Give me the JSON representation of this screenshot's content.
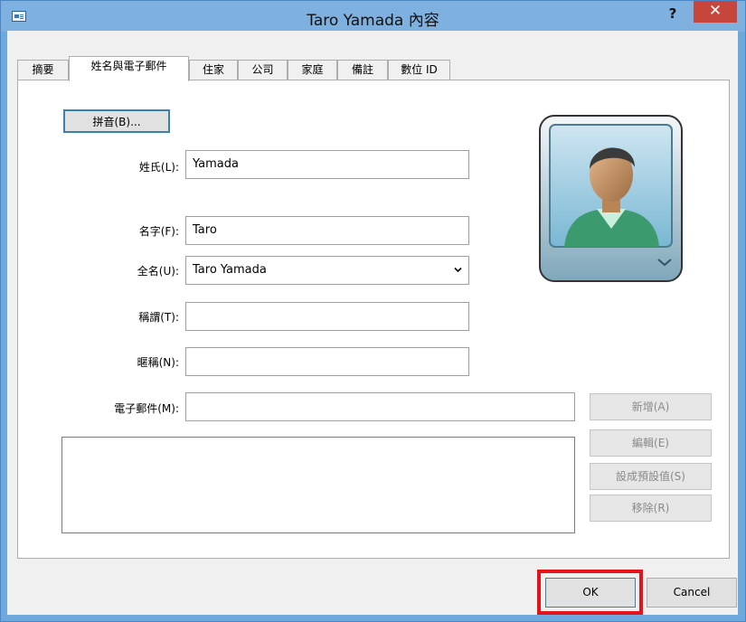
{
  "window": {
    "title": "Taro Yamada 內容",
    "help_label": "?",
    "close_label": "✕",
    "icon": "contact-card-icon"
  },
  "tabs": [
    {
      "label": "摘要"
    },
    {
      "label": "姓名與電子郵件"
    },
    {
      "label": "住家"
    },
    {
      "label": "公司"
    },
    {
      "label": "家庭"
    },
    {
      "label": "備註"
    },
    {
      "label": "數位 ID"
    }
  ],
  "active_tab": "姓名與電子郵件",
  "form": {
    "phonetic_button": "拼音(B)...",
    "last_name": {
      "label": "姓氏(L):",
      "value": "Yamada"
    },
    "first_name": {
      "label": "名字(F):",
      "value": "Taro"
    },
    "full_name": {
      "label": "全名(U):",
      "value": "Taro Yamada"
    },
    "title": {
      "label": "稱謂(T):",
      "value": ""
    },
    "nickname": {
      "label": "暱稱(N):",
      "value": ""
    },
    "email": {
      "label": "電子郵件(M):",
      "value": ""
    }
  },
  "email_buttons": {
    "add": "新增(A)",
    "edit": "編輯(E)",
    "set_default": "設成預設值(S)",
    "remove": "移除(R)"
  },
  "footer": {
    "ok": "OK",
    "cancel": "Cancel"
  },
  "colors": {
    "titlebar": "#7fb1e0",
    "close": "#c7453a",
    "highlight": "#e6131b"
  }
}
